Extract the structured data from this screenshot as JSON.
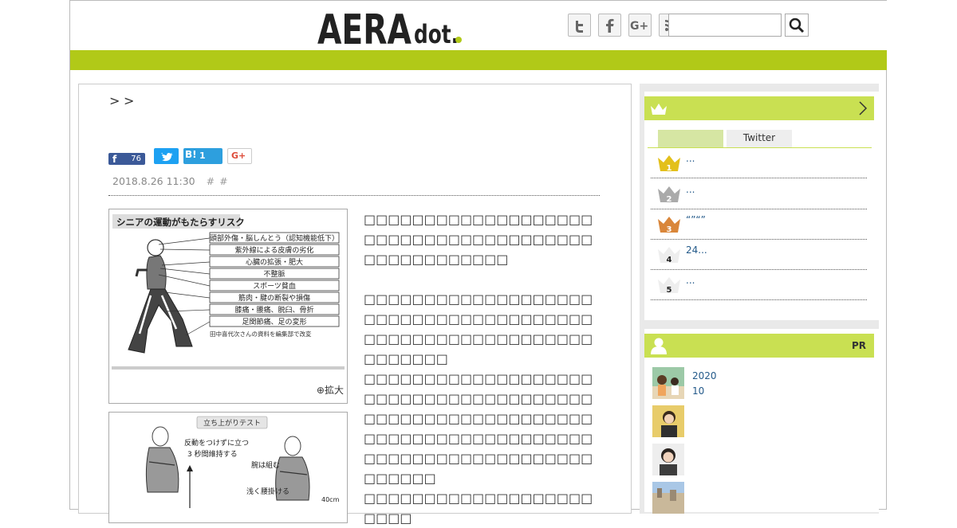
{
  "header": {
    "brand_main": "AERA",
    "brand_dot": "dot.",
    "social_icons": [
      "twitter-icon",
      "facebook-icon",
      "google-plus-icon",
      "rss-icon"
    ],
    "search": {
      "placeholder": ""
    },
    "colors": {
      "brand_green": "#b1c918",
      "panel_green": "#c9e052"
    }
  },
  "article": {
    "breadcrumb": [
      ">",
      ">"
    ],
    "share": {
      "facebook_count": "76",
      "hatena_label": "B!",
      "hatena_count": "1",
      "google_label": "G+"
    },
    "date": "2018.8.26 11:30",
    "tags": [
      "#",
      "#"
    ],
    "figure1": {
      "title": "シニアの運動がもたらすリスク",
      "items": [
        "頭部外傷・脳しんとう（認知機能低下）",
        "紫外線による皮膚の劣化",
        "心臓の拡張・肥大",
        "不整脈",
        "スポーツ貧血",
        "筋肉・腱の断裂や損傷",
        "膝痛・腰痛、脱臼、骨折",
        "足関節痛、足の変形"
      ],
      "source": "田中喜代次さんの資料を編集部で改変",
      "zoom_label": "拡大"
    },
    "figure2": {
      "title": "立ち上がりテスト",
      "label1": "反動をつけずに立つ",
      "label2": "3 秒間維持する",
      "label3": "腕は組む",
      "label4": "浅く腰掛ける",
      "label5": "40cm"
    },
    "paragraphs": [
      "□□□□□□□□□□□□□□□□□□□□□□□□□□□□□□□□□□□□□□□□□□□□□□□□□□",
      "□□□□□□□□□□□□□□□□□□□□□□□□□□□□□□□□□□□□□□□□□□□□□□□□□□□□□□□□□□□□□□□□",
      "□□□□□□□□□□□□□□□□□□□□□□□□□□□□□□□□□□□□□□□□□□□□□□□□□□□□□□□□□□□□□□□□□□□□□□□□□□□□□□□□□□□□□□□□□□□□□□□□□□□□□",
      "□□□□□□□□□□□□□□□□□□□□□□□"
    ]
  },
  "sidebar": {
    "ranking": {
      "tabs": [
        "",
        "Twitter"
      ],
      "items": [
        {
          "rank": "1",
          "text": "..."
        },
        {
          "rank": "2",
          "text": "..."
        },
        {
          "rank": "3",
          "text": "“”“”"
        },
        {
          "rank": "4",
          "text": "24..."
        },
        {
          "rank": "5",
          "text": "..."
        }
      ]
    },
    "pr": {
      "label": "PR",
      "items": [
        {
          "line1": "2020",
          "line2": "10"
        },
        {
          "line1": "",
          "line2": ""
        },
        {
          "line1": "",
          "line2": ""
        },
        {
          "line1": "",
          "line2": ""
        }
      ]
    }
  }
}
